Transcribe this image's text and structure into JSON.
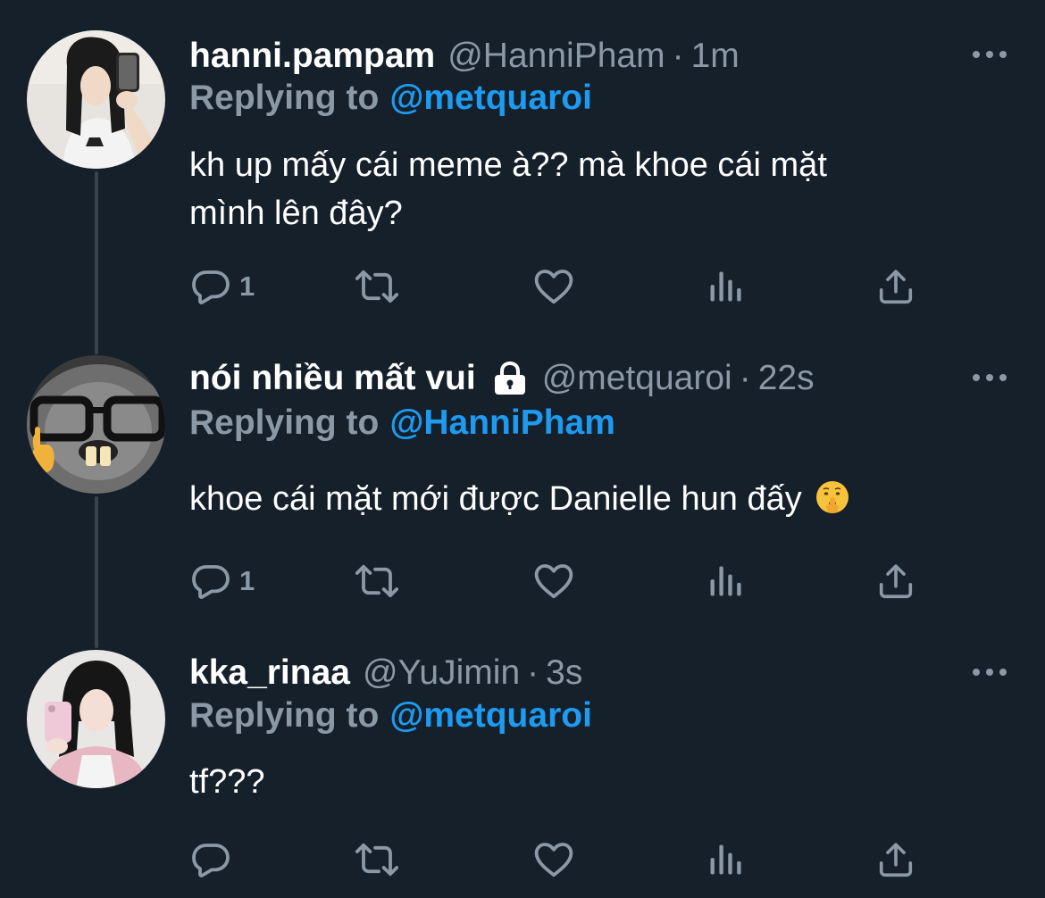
{
  "colors": {
    "background": "#15202b",
    "text": "#ffffff",
    "muted": "#8b98a5",
    "link": "#1d9bf0",
    "thread_line": "#38444d"
  },
  "replying_label": "Replying to",
  "tweets": [
    {
      "display_name": "hanni.pampam",
      "handle": "@HanniPham",
      "separator": "·",
      "time": "1m",
      "reply_to": "@metquaroi",
      "text_lines": [
        "kh up mấy cái meme à?? mà khoe cái mặt",
        "mình lên đây?"
      ],
      "protected": false,
      "reply_count": "1",
      "icons": [
        "reply-icon",
        "retweet-icon",
        "like-icon",
        "views-icon",
        "share-icon",
        "more-icon"
      ]
    },
    {
      "display_name": "nói nhiều mất vui",
      "handle": "@metquaroi",
      "separator": "·",
      "time": "22s",
      "reply_to": "@HanniPham",
      "text_lines": [
        "khoe cái mặt mới được Danielle hun đấy"
      ],
      "emoji": "shushing-face-emoji",
      "protected": true,
      "reply_count": "1",
      "icons": [
        "reply-icon",
        "retweet-icon",
        "like-icon",
        "views-icon",
        "share-icon",
        "more-icon",
        "lock-icon"
      ]
    },
    {
      "display_name": "kka_rinaa",
      "handle": "@YuJimin",
      "separator": "·",
      "time": "3s",
      "reply_to": "@metquaroi",
      "text_lines": [
        "tf???"
      ],
      "protected": false,
      "reply_count": "",
      "icons": [
        "reply-icon",
        "retweet-icon",
        "like-icon",
        "views-icon",
        "share-icon",
        "more-icon"
      ]
    }
  ]
}
